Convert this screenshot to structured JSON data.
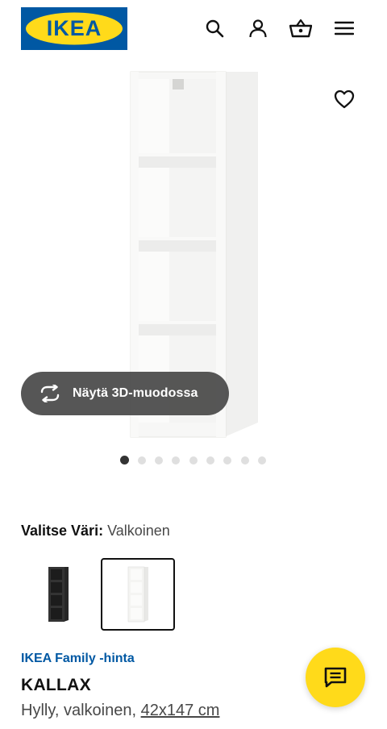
{
  "header": {
    "logo_text": "IKEA",
    "icons": [
      "search-icon",
      "account-icon",
      "basket-icon",
      "menu-icon"
    ]
  },
  "gallery": {
    "view_3d_label": "Näytä 3D-muodossa",
    "image_count": 9,
    "active_index": 0
  },
  "color_picker": {
    "label": "Valitse Väri:",
    "selected_value": "Valkoinen",
    "options": [
      "black-brown",
      "white"
    ],
    "selected_option": "white"
  },
  "product": {
    "family_price_label": "IKEA Family -hinta",
    "name": "KALLAX",
    "description": "Hylly, valkoinen,",
    "size": "42x147 cm"
  },
  "colors": {
    "ikea_blue": "#0058a3",
    "ikea_yellow": "#ffda1a",
    "link_blue": "#0058a3"
  }
}
